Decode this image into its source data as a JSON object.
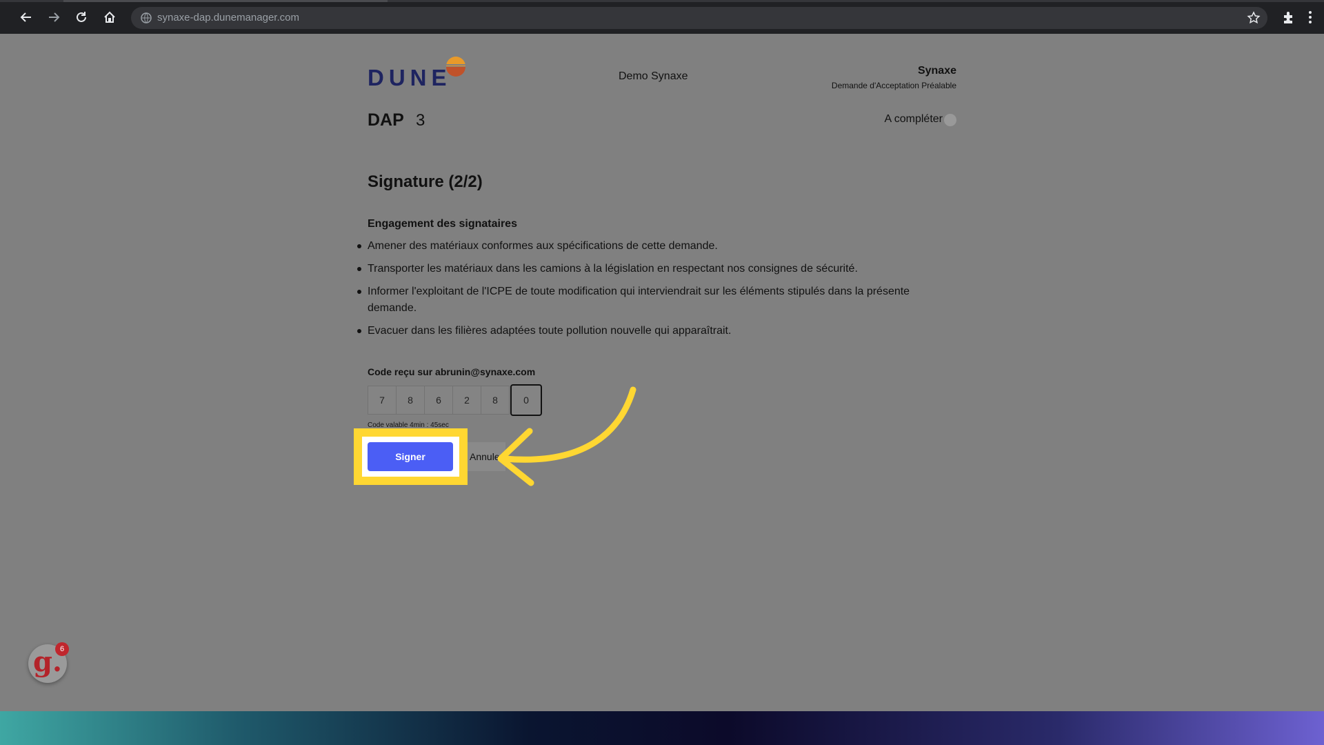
{
  "browser": {
    "url": "synaxe-dap.dunemanager.com"
  },
  "header": {
    "logo_text": "DUNE",
    "company": "Demo Synaxe",
    "client_name": "Synaxe",
    "client_subtitle": "Demande d'Acceptation Préalable"
  },
  "dap": {
    "label": "DAP",
    "number": "3",
    "status": "A compléter"
  },
  "signature": {
    "title": "Signature (2/2)",
    "commitments_title": "Engagement des signataires",
    "commitments": [
      "Amener des matériaux conformes aux spécifications de cette demande.",
      "Transporter les matériaux dans les camions à la législation en respectant nos consignes de sécurité.",
      "Informer l'exploitant de l'ICPE de toute modification qui interviendrait sur les éléments stipulés dans la présente demande.",
      "Evacuer dans les filières adaptées toute pollution nouvelle qui apparaîtrait."
    ],
    "code_label": "Code reçu sur abrunin@synaxe.com",
    "code_digits": [
      "7",
      "8",
      "6",
      "2",
      "8",
      "0"
    ],
    "code_validity": "Code valable 4min : 45sec",
    "sign_label": "Signer",
    "cancel_label": "Annuler"
  },
  "widget": {
    "logo": "g.",
    "badge_count": "6"
  },
  "colors": {
    "primary_button": "#4b5ef5",
    "highlight": "#ffd732",
    "logo_navy": "#1e2460"
  }
}
